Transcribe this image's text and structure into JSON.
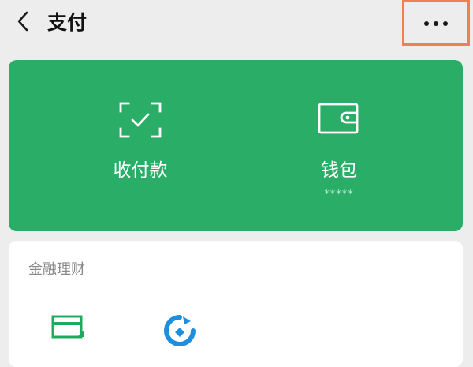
{
  "header": {
    "title": "支付"
  },
  "card": {
    "actions": [
      {
        "label": "收付款"
      },
      {
        "label": "钱包",
        "masked_value": "*****"
      }
    ]
  },
  "finance": {
    "title": "金融理财"
  },
  "colors": {
    "card_green": "#2aae67",
    "background": "#ededed",
    "highlight_border": "#f0804f"
  }
}
